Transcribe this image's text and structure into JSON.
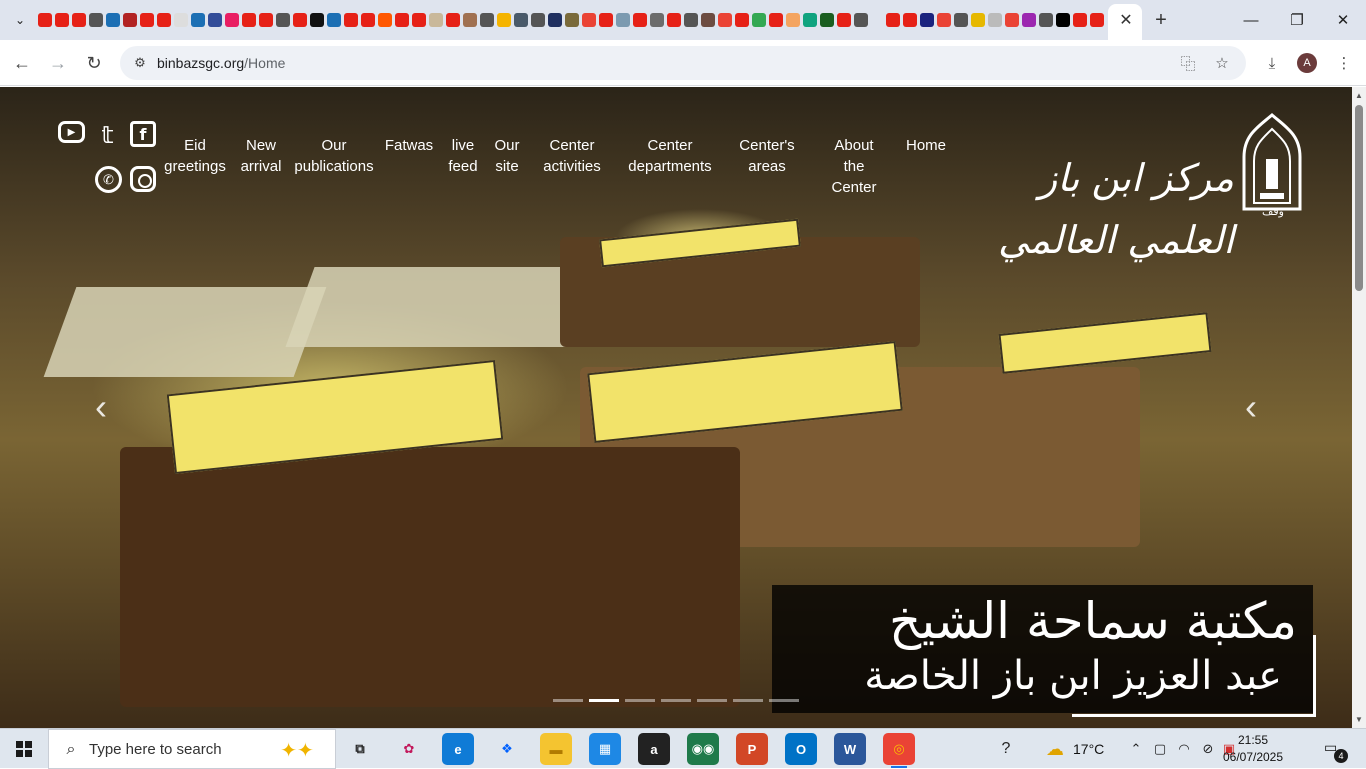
{
  "browser": {
    "tab_close_glyph": "✕",
    "new_tab_glyph": "+",
    "window_controls": {
      "minimize": "—",
      "maximize": "❐",
      "close": "✕"
    },
    "toolbar": {
      "back": "←",
      "forward": "→",
      "reload": "↻"
    },
    "address": {
      "domain": "binbazsgc.org",
      "path": "/Home"
    },
    "profile_initial": "A",
    "favicon_colors": [
      "#e62117",
      "#e62117",
      "#e62117",
      "#555555",
      "#1c6fb4",
      "#b22222",
      "#e62117",
      "#e62117",
      "#dddddd",
      "#1c6fb4",
      "#334d99",
      "#e91e63",
      "#e62117",
      "#e62117",
      "#555555",
      "#e62117",
      "#111111",
      "#1c6fb4",
      "#e62117",
      "#e62117",
      "#ff5700",
      "#e62117",
      "#e62117",
      "#c9b89a",
      "#e62117",
      "#a07050",
      "#555555",
      "#f5b400",
      "#4a5a6a",
      "#555555",
      "#203060",
      "#7a6a3a",
      "#ea4335",
      "#e62117",
      "#7c9ab0",
      "#e62117",
      "#6c6c6c",
      "#e62117",
      "#555555",
      "#6d4c41",
      "#ea4335",
      "#e62117",
      "#34a853",
      "#e62117",
      "#f4a460",
      "#10a37f",
      "#1b5e20",
      "#e62117",
      "#555555",
      "#e62117",
      "#e62117",
      "#1a237e",
      "#ea4335",
      "#555555",
      "#e6b800",
      "#bbbbbb",
      "#ea4335",
      "#9c27b0",
      "#555555",
      "#000000",
      "#e62117",
      "#e62117",
      "#ea4335",
      "#4285f4"
    ]
  },
  "site": {
    "nav": [
      "Eid greetings",
      "New arrival",
      "Our publications",
      "Fatwas",
      "live feed",
      "Our site",
      "Center activities",
      "Center departments",
      "Center's areas",
      "About the Center",
      "Home"
    ],
    "logo_text": "مركز ابن باز العلمي العالمي",
    "logo_sub": "وقف",
    "slider": {
      "prev_glyph": "‹",
      "next_glyph": "‹",
      "caption_line1": "مكتبة سماحة الشيخ",
      "caption_line2": "عبد العزيز ابن باز الخاصة",
      "indicator_count": 7,
      "active_indicator": 1
    },
    "social": {
      "youtube": "▶",
      "twitter": "🐦",
      "facebook": "f",
      "whatsapp": "✆",
      "instagram": ""
    }
  },
  "taskbar": {
    "search_placeholder": "Type here to search",
    "weather_temp": "17°C",
    "time": "21:55",
    "date": "06/07/2025",
    "notification_count": "4",
    "apps": [
      {
        "name": "task-view",
        "glyph": "⧉",
        "color": "transparent",
        "text_color": "#222222"
      },
      {
        "name": "copilot",
        "glyph": "✿",
        "color": "transparent",
        "text_color": "#c2185b"
      },
      {
        "name": "edge",
        "glyph": "e",
        "color": "#0f7bd6",
        "text_color": "#ffffff"
      },
      {
        "name": "dropbox",
        "glyph": "❖",
        "color": "transparent",
        "text_color": "#0061fe"
      },
      {
        "name": "file-explorer",
        "glyph": "▬",
        "color": "#f4c430",
        "text_color": "#b07a00"
      },
      {
        "name": "microsoft-store",
        "glyph": "▦",
        "color": "#1e88e5",
        "text_color": "#ffffff"
      },
      {
        "name": "amazon",
        "glyph": "a",
        "color": "#222222",
        "text_color": "#ffffff"
      },
      {
        "name": "tripadvisor",
        "glyph": "◉◉",
        "color": "#1f7a4a",
        "text_color": "#ffffff"
      },
      {
        "name": "powerpoint",
        "glyph": "P",
        "color": "#d24726",
        "text_color": "#ffffff"
      },
      {
        "name": "outlook",
        "glyph": "O",
        "color": "#0072c6",
        "text_color": "#ffffff"
      },
      {
        "name": "word",
        "glyph": "W",
        "color": "#2b579a",
        "text_color": "#ffffff"
      },
      {
        "name": "chrome",
        "glyph": "◎",
        "color": "#ea4335",
        "text_color": "#fbbc05"
      }
    ]
  }
}
